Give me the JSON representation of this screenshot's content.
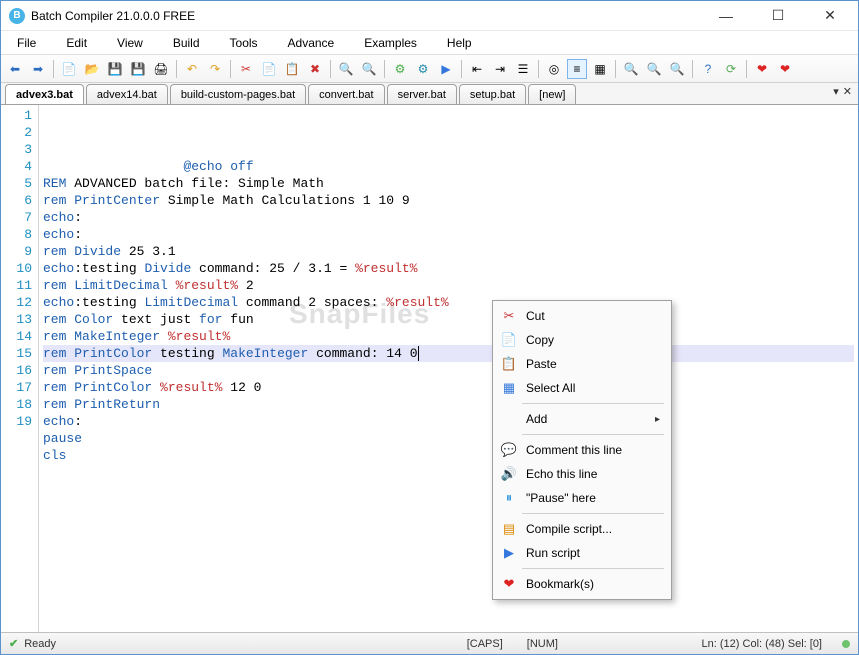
{
  "window": {
    "title": "Batch Compiler 21.0.0.0 FREE",
    "app_icon_letter": "B"
  },
  "menu": [
    "File",
    "Edit",
    "View",
    "Build",
    "Tools",
    "Advance",
    "Examples",
    "Help"
  ],
  "tabs": {
    "items": [
      "advex3.bat",
      "advex14.bat",
      "build-custom-pages.bat",
      "convert.bat",
      "server.bat",
      "setup.bat",
      "[new]"
    ],
    "active_index": 0
  },
  "editor": {
    "lines": [
      {
        "n": 1,
        "segments": [
          {
            "t": "                  ",
            "c": ""
          },
          {
            "t": "@echo off",
            "c": "tk-blue"
          }
        ]
      },
      {
        "n": 2,
        "segments": [
          {
            "t": "REM ",
            "c": "tk-blue"
          },
          {
            "t": "ADVANCED batch file: Simple Math",
            "c": "tk-dark"
          }
        ]
      },
      {
        "n": 3,
        "segments": [
          {
            "t": "rem ",
            "c": "tk-blue"
          },
          {
            "t": "PrintCenter ",
            "c": "tk-blue"
          },
          {
            "t": "Simple Math Calculations 1 10 9",
            "c": "tk-dark"
          }
        ]
      },
      {
        "n": 4,
        "segments": [
          {
            "t": "echo",
            "c": "tk-blue"
          },
          {
            "t": ":",
            "c": "tk-dark"
          }
        ]
      },
      {
        "n": 5,
        "segments": [
          {
            "t": "echo",
            "c": "tk-blue"
          },
          {
            "t": ":",
            "c": "tk-dark"
          }
        ]
      },
      {
        "n": 6,
        "segments": [
          {
            "t": "rem ",
            "c": "tk-blue"
          },
          {
            "t": "Divide ",
            "c": "tk-blue"
          },
          {
            "t": "25 3.1",
            "c": "tk-dark"
          }
        ]
      },
      {
        "n": 7,
        "segments": [
          {
            "t": "echo",
            "c": "tk-blue"
          },
          {
            "t": ":testing ",
            "c": "tk-dark"
          },
          {
            "t": "Divide ",
            "c": "tk-blue"
          },
          {
            "t": "command: 25 / 3.1 = ",
            "c": "tk-dark"
          },
          {
            "t": "%result%",
            "c": "tk-red"
          }
        ]
      },
      {
        "n": 8,
        "segments": [
          {
            "t": "rem ",
            "c": "tk-blue"
          },
          {
            "t": "LimitDecimal ",
            "c": "tk-blue"
          },
          {
            "t": "%result% ",
            "c": "tk-red"
          },
          {
            "t": "2",
            "c": "tk-dark"
          }
        ]
      },
      {
        "n": 9,
        "segments": [
          {
            "t": "echo",
            "c": "tk-blue"
          },
          {
            "t": ":testing ",
            "c": "tk-dark"
          },
          {
            "t": "LimitDecimal ",
            "c": "tk-blue"
          },
          {
            "t": "command 2 spaces: ",
            "c": "tk-dark"
          },
          {
            "t": "%result%",
            "c": "tk-red"
          }
        ]
      },
      {
        "n": 10,
        "segments": [
          {
            "t": "rem ",
            "c": "tk-blue"
          },
          {
            "t": "Color ",
            "c": "tk-blue"
          },
          {
            "t": "text just ",
            "c": "tk-dark"
          },
          {
            "t": "for ",
            "c": "tk-blue"
          },
          {
            "t": "fun",
            "c": "tk-dark"
          }
        ]
      },
      {
        "n": 11,
        "segments": [
          {
            "t": "rem ",
            "c": "tk-blue"
          },
          {
            "t": "MakeInteger ",
            "c": "tk-blue"
          },
          {
            "t": "%result%",
            "c": "tk-red"
          }
        ]
      },
      {
        "n": 12,
        "selected": true,
        "segments": [
          {
            "t": "rem ",
            "c": "tk-blue"
          },
          {
            "t": "PrintColor ",
            "c": "tk-blue"
          },
          {
            "t": "testing ",
            "c": "tk-dark"
          },
          {
            "t": "MakeInteger ",
            "c": "tk-blue"
          },
          {
            "t": "command: 14 0",
            "c": "tk-dark"
          }
        ]
      },
      {
        "n": 13,
        "segments": [
          {
            "t": "rem ",
            "c": "tk-blue"
          },
          {
            "t": "PrintSpace",
            "c": "tk-blue"
          }
        ]
      },
      {
        "n": 14,
        "segments": [
          {
            "t": "rem ",
            "c": "tk-blue"
          },
          {
            "t": "PrintColor ",
            "c": "tk-blue"
          },
          {
            "t": "%result% ",
            "c": "tk-red"
          },
          {
            "t": "12 0",
            "c": "tk-dark"
          }
        ]
      },
      {
        "n": 15,
        "segments": [
          {
            "t": "rem ",
            "c": "tk-blue"
          },
          {
            "t": "PrintReturn",
            "c": "tk-blue"
          }
        ]
      },
      {
        "n": 16,
        "segments": [
          {
            "t": "echo",
            "c": "tk-blue"
          },
          {
            "t": ":",
            "c": "tk-dark"
          }
        ]
      },
      {
        "n": 17,
        "segments": [
          {
            "t": "pause",
            "c": "tk-blue"
          }
        ]
      },
      {
        "n": 18,
        "segments": [
          {
            "t": "cls",
            "c": "tk-blue"
          }
        ]
      },
      {
        "n": 19,
        "segments": []
      }
    ]
  },
  "context_menu": {
    "groups": [
      [
        {
          "icon": "✂",
          "label": "Cut",
          "color": "#c33"
        },
        {
          "icon": "📄",
          "label": "Copy"
        },
        {
          "icon": "📋",
          "label": "Paste"
        },
        {
          "icon": "▦",
          "label": "Select All",
          "color": "#37d"
        }
      ],
      [
        {
          "icon": "",
          "label": "Add",
          "submenu": true
        }
      ],
      [
        {
          "icon": "💬",
          "label": "Comment this line",
          "color": "#e7a"
        },
        {
          "icon": "🔊",
          "label": "Echo this line",
          "color": "#e90"
        },
        {
          "icon": "⏸",
          "label": "\"Pause\" here",
          "color": "#39d"
        }
      ],
      [
        {
          "icon": "▤",
          "label": "Compile script...",
          "color": "#d80"
        },
        {
          "icon": "▶",
          "label": "Run script",
          "color": "#37d"
        }
      ],
      [
        {
          "icon": "❤",
          "label": "Bookmark(s)",
          "color": "#d22"
        }
      ]
    ]
  },
  "status": {
    "ready": "Ready",
    "caps": "[CAPS]",
    "num": "[NUM]",
    "pos": "Ln:  (12)  Col:  (48)  Sel:  [0]"
  },
  "watermark": "SnapFiles"
}
